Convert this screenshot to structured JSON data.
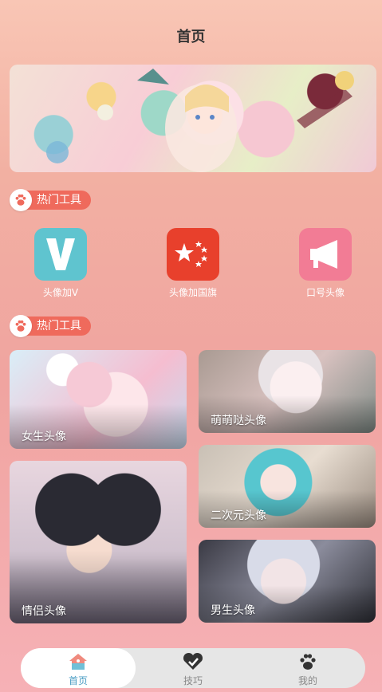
{
  "header": {
    "title": "首页"
  },
  "sections": [
    {
      "title": "热门工具"
    },
    {
      "title": "热门工具"
    }
  ],
  "tools": [
    {
      "label": "头像加V",
      "icon": "v-letter-icon",
      "color": "#5fc4cf"
    },
    {
      "label": "头像加国旗",
      "icon": "china-flag-icon",
      "color": "#e8402c"
    },
    {
      "label": "口号头像",
      "icon": "megaphone-icon",
      "color": "#f27c95"
    }
  ],
  "cards": [
    {
      "label": "女生头像"
    },
    {
      "label": "萌萌哒头像"
    },
    {
      "label": "情侣头像"
    },
    {
      "label": "二次元头像"
    },
    {
      "label": "男生头像"
    }
  ],
  "tabbar": {
    "tabs": [
      {
        "label": "首页",
        "icon": "home-icon",
        "active": true
      },
      {
        "label": "技巧",
        "icon": "heart-check-icon",
        "active": false
      },
      {
        "label": "我的",
        "icon": "paw-icon",
        "active": false
      }
    ],
    "active_color": "#4b9ec4",
    "inactive_color": "#888888"
  }
}
